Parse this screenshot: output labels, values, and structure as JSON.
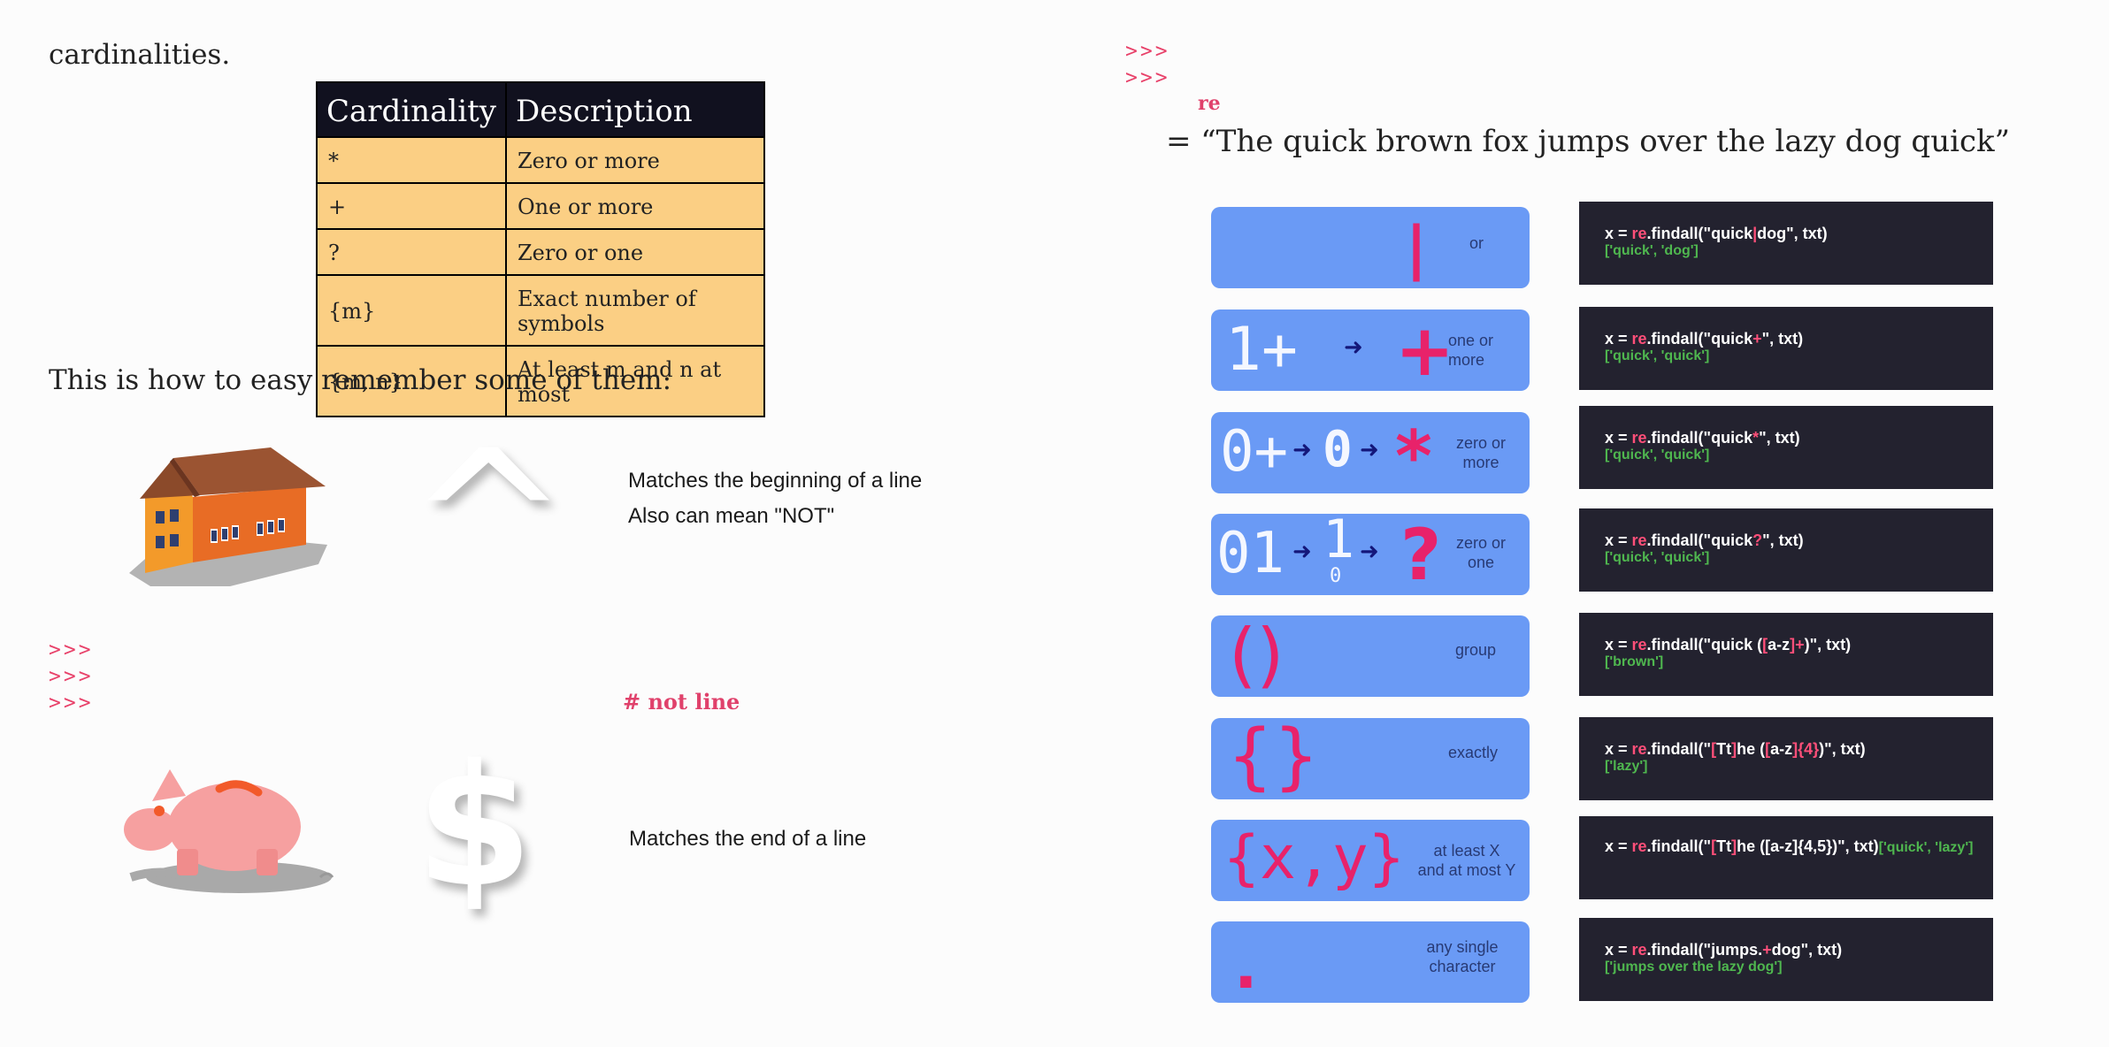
{
  "left": {
    "intro": "cardinalities.",
    "table": {
      "headers": [
        "Cardinality",
        "Description"
      ],
      "rows": [
        [
          "*",
          "Zero or more"
        ],
        [
          "+",
          "One or more"
        ],
        [
          "?",
          "Zero or one"
        ],
        [
          "{m}",
          "Exact number of symbols"
        ],
        [
          "{m, n}",
          "At least m and n at most"
        ]
      ]
    },
    "remember": "This is how to easy remember some of them:",
    "caret": {
      "symbol": "^",
      "desc1": "Matches the beginning of a line",
      "desc2": "Also can mean \"NOT\""
    },
    "prompts": [
      ">>>",
      ">>>",
      ">>>"
    ],
    "comment": "# not line",
    "dollar": {
      "symbol": "$",
      "desc": "Matches the end of a line"
    }
  },
  "right": {
    "prompts": [
      ">>>",
      ">>>"
    ],
    "module": "re",
    "txt_line": "= “The quick brown fox jumps over the lazy dog quick”",
    "cards": [
      {
        "label": "or",
        "symbol": "|"
      },
      {
        "label1": "one or",
        "label2": "more",
        "digits": "1+",
        "symbol": "+"
      },
      {
        "label1": "zero or",
        "label2": "more",
        "digits": "0+",
        "mid": "0",
        "symbol": "*"
      },
      {
        "label1": "zero or",
        "label2": "one",
        "digits": "01",
        "mid_top": "1",
        "mid_bottom": "0",
        "symbol": "?"
      },
      {
        "label": "group",
        "symbol": "()"
      },
      {
        "label": "exactly",
        "symbol": "{}"
      },
      {
        "label1": "at least X",
        "label2": "and at most Y",
        "symbol": "{x,y}"
      },
      {
        "label1": "any single",
        "label2": "character",
        "symbol": "."
      }
    ],
    "code": [
      {
        "pre": "x = ",
        "mod": "re",
        "a": ".findall(\"quick",
        "b": "|",
        "c": "dog\", txt)",
        "result": "['quick', 'dog']"
      },
      {
        "pre": "x = ",
        "mod": "re",
        "a": ".findall(\"quick",
        "b": "+",
        "c": "\", txt)",
        "result": "['quick', 'quick']"
      },
      {
        "pre": "x = ",
        "mod": "re",
        "a": ".findall(\"quick",
        "b": "*",
        "c": "\", txt)",
        "result": "['quick', 'quick']"
      },
      {
        "pre": "x = ",
        "mod": "re",
        "a": ".findall(\"quick",
        "b": "?",
        "c": "\", txt)",
        "result": "['quick', 'quick']"
      },
      {
        "pre": "x = ",
        "mod": "re",
        "a": ".findall(\"quick (",
        "b": "[",
        "c": "a-z",
        "d": "]+",
        "e": ")\", txt)",
        "result": "['brown']"
      },
      {
        "pre": "x = ",
        "mod": "re",
        "a": ".findall(\"",
        "b": "[",
        "c": "Tt",
        "d": "]",
        "e": "he (",
        "f": "[",
        "g": "a-z",
        "h": "]{4}",
        "i": ")\", txt)",
        "result": "['lazy']"
      },
      {
        "pre": "x = ",
        "mod": "re",
        "a": ".findall(\"",
        "b": "[",
        "c": "Tt",
        "d": "]",
        "e": "he (",
        "f": "[a-z]{4,5}",
        "i": ")\", txt)",
        "result": "['quick', 'lazy']"
      },
      {
        "pre": "x = ",
        "mod": "re",
        "a": ".findall(\"jumps.",
        "b": "+",
        "c": "dog\", txt)",
        "result": "['jumps over the lazy dog']"
      }
    ]
  },
  "colors": {
    "card_blue": "#6a9af5",
    "code_bg": "#23222f",
    "accent_pink": "#e8226a",
    "result_green": "#4fb74f",
    "table_header": "#11111f",
    "table_cell": "#fbcf84"
  }
}
